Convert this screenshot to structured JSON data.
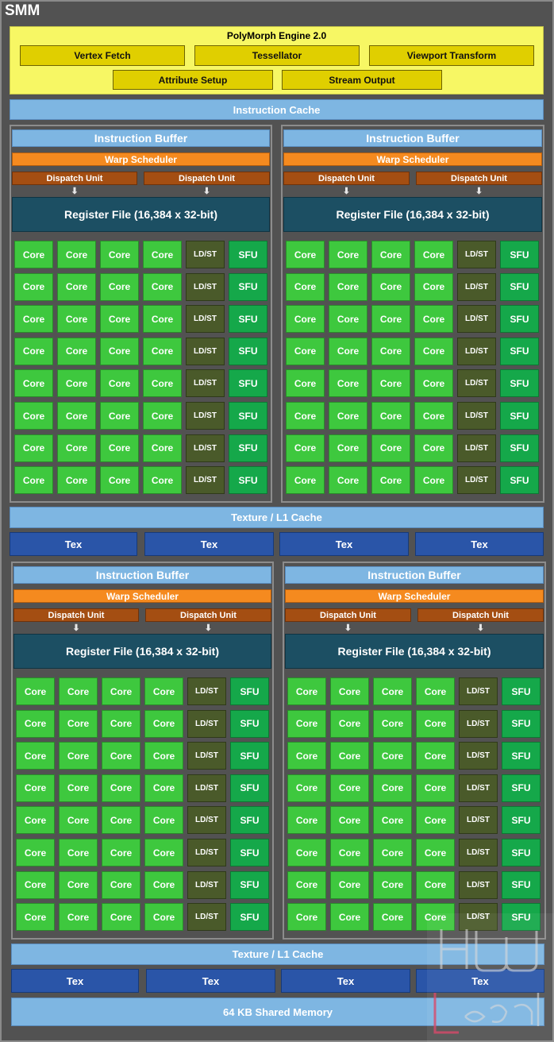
{
  "diagram": {
    "title": "SMM",
    "polymorph": {
      "title": "PolyMorph Engine 2.0",
      "units_row1": [
        "Vertex Fetch",
        "Tessellator",
        "Viewport Transform"
      ],
      "units_row2": [
        "Attribute Setup",
        "Stream Output"
      ]
    },
    "instruction_cache": "Instruction Cache",
    "processing_block": {
      "instruction_buffer": "Instruction Buffer",
      "warp_scheduler": "Warp Scheduler",
      "dispatch_unit": "Dispatch Unit",
      "register_file": "Register File (16,384 x 32-bit)",
      "core_label": "Core",
      "ldst_label": "LD/ST",
      "sfu_label": "SFU",
      "rows": 8,
      "cores_per_row": 4
    },
    "texture_l1_cache": "Texture / L1 Cache",
    "tex_unit": "Tex",
    "shared_memory": "64 KB Shared Memory",
    "watermark": "HW Legend",
    "colors": {
      "background": "#525252",
      "polymorph": "#f7f764",
      "polymorph_unit": "#e0cf00",
      "cache": "#7eb6e2",
      "warp_scheduler": "#f58a1f",
      "dispatch_unit": "#a44e12",
      "register_file": "#1c4f63",
      "core": "#3ec83e",
      "ldst": "#4a5a2a",
      "sfu": "#15a84a",
      "tex": "#2a55a8"
    }
  }
}
